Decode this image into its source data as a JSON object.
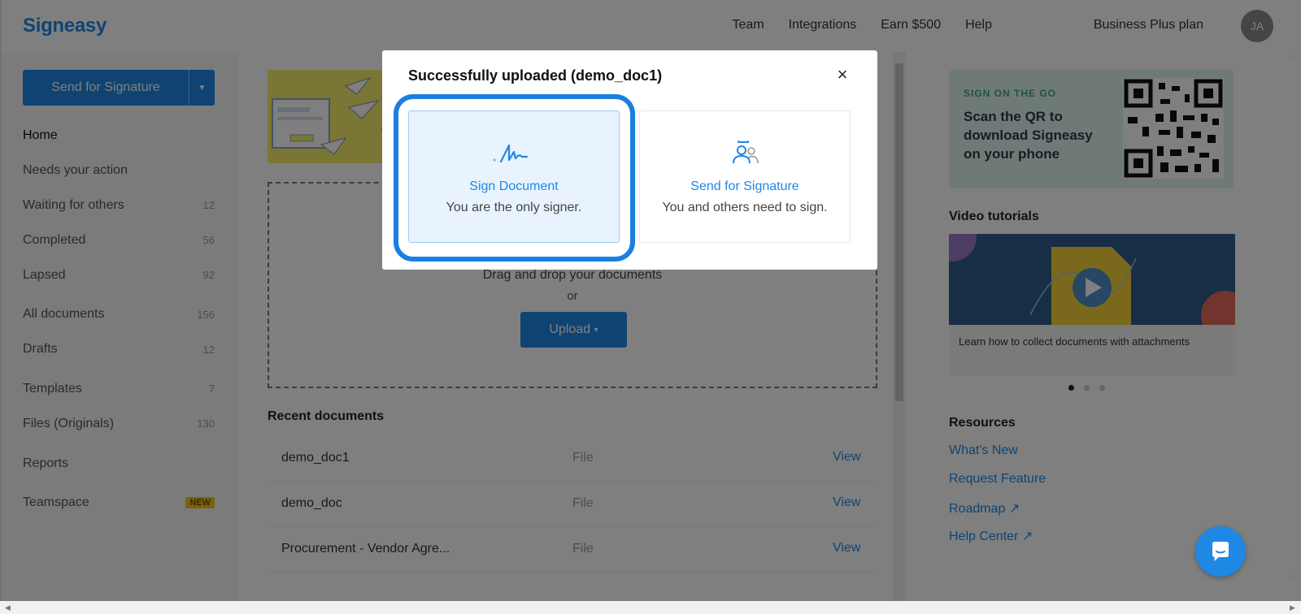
{
  "app": {
    "logo": "Signeasy"
  },
  "topnav": {
    "items": [
      "Team",
      "Integrations",
      "Earn $500",
      "Help"
    ],
    "plan": "Business Plus plan",
    "avatar_initials": "JA"
  },
  "sidebar": {
    "send_button": "Send for Signature",
    "items": [
      {
        "label": "Home",
        "count": ""
      },
      {
        "label": "Needs your action",
        "count": ""
      },
      {
        "label": "Waiting for others",
        "count": "12"
      },
      {
        "label": "Completed",
        "count": "56"
      },
      {
        "label": "Lapsed",
        "count": "92"
      },
      {
        "label": "All documents",
        "count": "156"
      },
      {
        "label": "Drafts",
        "count": "12"
      },
      {
        "label": "Templates",
        "count": "7"
      },
      {
        "label": "Files (Originals)",
        "count": "130"
      },
      {
        "label": "Reports",
        "count": ""
      },
      {
        "label": "Teamspace",
        "count": "",
        "badge": "NEW"
      }
    ]
  },
  "main": {
    "dropzone_text": "Drag and drop your documents",
    "dropzone_or": "or",
    "upload_button": "Upload",
    "recent_title": "Recent documents",
    "recent": [
      {
        "name": "demo_doc1",
        "type": "File",
        "action": "View"
      },
      {
        "name": "demo_doc",
        "type": "File",
        "action": "View"
      },
      {
        "name": "Procurement - Vendor Agre...",
        "type": "File",
        "action": "View"
      }
    ]
  },
  "right": {
    "qr_kicker": "SIGN ON THE GO",
    "qr_text": "Scan the QR to download Signeasy on your phone",
    "video_title": "Video tutorials",
    "video_caption": "Learn how to collect documents with attachments",
    "resources_title": "Resources",
    "resources": [
      "What's New",
      "Request Feature",
      "Roadmap ↗",
      "Help Center ↗"
    ]
  },
  "modal": {
    "title": "Successfully uploaded (demo_doc1)",
    "options": [
      {
        "title": "Sign Document",
        "subtitle": "You are the only signer."
      },
      {
        "title": "Send for Signature",
        "subtitle": "You and others need to sign."
      }
    ]
  },
  "colors": {
    "accent": "#1e88e5",
    "highlight": "#1a7fe0",
    "badge": "#f5c518"
  }
}
